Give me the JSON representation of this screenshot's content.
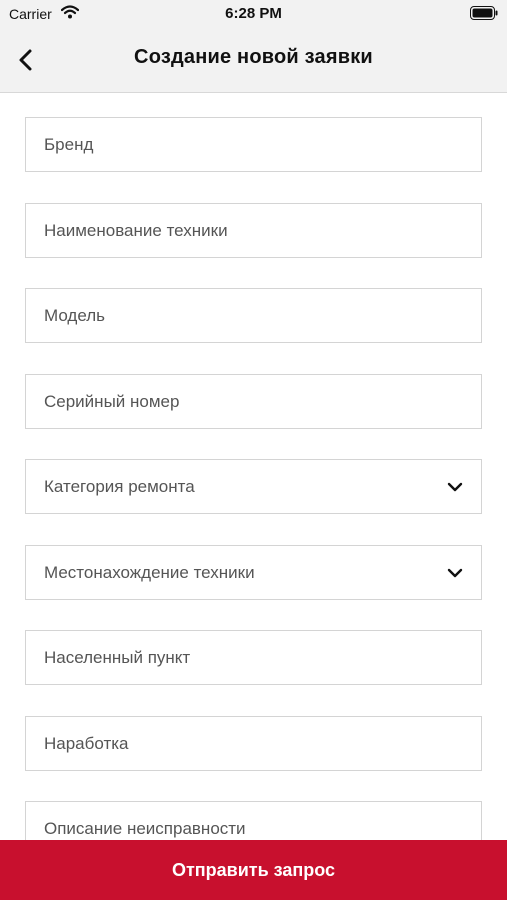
{
  "status": {
    "carrier": "Carrier",
    "time": "6:28 PM"
  },
  "header": {
    "title": "Создание новой заявки",
    "back_icon": "chevron-left-icon"
  },
  "form": {
    "fields": [
      {
        "placeholder": "Бренд",
        "type": "input"
      },
      {
        "placeholder": "Наименование техники",
        "type": "input"
      },
      {
        "placeholder": "Модель",
        "type": "input"
      },
      {
        "placeholder": "Серийный номер",
        "type": "input"
      },
      {
        "placeholder": "Категория ремонта",
        "type": "select"
      },
      {
        "placeholder": "Местонахождение техники",
        "type": "select"
      },
      {
        "placeholder": "Населенный пункт",
        "type": "input"
      },
      {
        "placeholder": "Наработка",
        "type": "input"
      },
      {
        "placeholder": "Описание неисправности",
        "type": "input"
      }
    ]
  },
  "footer": {
    "submit_label": "Отправить запрос"
  },
  "colors": {
    "accent": "#c8102e",
    "bar_background": "#f2f2f2"
  }
}
